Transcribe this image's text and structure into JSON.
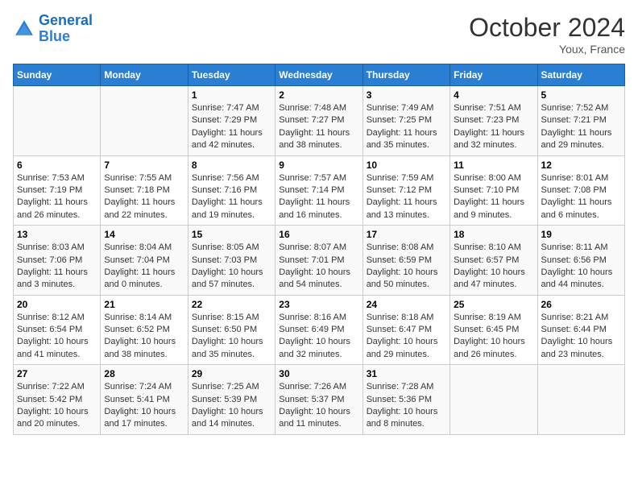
{
  "logo": {
    "line1": "General",
    "line2": "Blue"
  },
  "title": "October 2024",
  "location": "Youx, France",
  "days_of_week": [
    "Sunday",
    "Monday",
    "Tuesday",
    "Wednesday",
    "Thursday",
    "Friday",
    "Saturday"
  ],
  "weeks": [
    [
      {
        "day": "",
        "sunrise": "",
        "sunset": "",
        "daylight": ""
      },
      {
        "day": "",
        "sunrise": "",
        "sunset": "",
        "daylight": ""
      },
      {
        "day": "1",
        "sunrise": "Sunrise: 7:47 AM",
        "sunset": "Sunset: 7:29 PM",
        "daylight": "Daylight: 11 hours and 42 minutes."
      },
      {
        "day": "2",
        "sunrise": "Sunrise: 7:48 AM",
        "sunset": "Sunset: 7:27 PM",
        "daylight": "Daylight: 11 hours and 38 minutes."
      },
      {
        "day": "3",
        "sunrise": "Sunrise: 7:49 AM",
        "sunset": "Sunset: 7:25 PM",
        "daylight": "Daylight: 11 hours and 35 minutes."
      },
      {
        "day": "4",
        "sunrise": "Sunrise: 7:51 AM",
        "sunset": "Sunset: 7:23 PM",
        "daylight": "Daylight: 11 hours and 32 minutes."
      },
      {
        "day": "5",
        "sunrise": "Sunrise: 7:52 AM",
        "sunset": "Sunset: 7:21 PM",
        "daylight": "Daylight: 11 hours and 29 minutes."
      }
    ],
    [
      {
        "day": "6",
        "sunrise": "Sunrise: 7:53 AM",
        "sunset": "Sunset: 7:19 PM",
        "daylight": "Daylight: 11 hours and 26 minutes."
      },
      {
        "day": "7",
        "sunrise": "Sunrise: 7:55 AM",
        "sunset": "Sunset: 7:18 PM",
        "daylight": "Daylight: 11 hours and 22 minutes."
      },
      {
        "day": "8",
        "sunrise": "Sunrise: 7:56 AM",
        "sunset": "Sunset: 7:16 PM",
        "daylight": "Daylight: 11 hours and 19 minutes."
      },
      {
        "day": "9",
        "sunrise": "Sunrise: 7:57 AM",
        "sunset": "Sunset: 7:14 PM",
        "daylight": "Daylight: 11 hours and 16 minutes."
      },
      {
        "day": "10",
        "sunrise": "Sunrise: 7:59 AM",
        "sunset": "Sunset: 7:12 PM",
        "daylight": "Daylight: 11 hours and 13 minutes."
      },
      {
        "day": "11",
        "sunrise": "Sunrise: 8:00 AM",
        "sunset": "Sunset: 7:10 PM",
        "daylight": "Daylight: 11 hours and 9 minutes."
      },
      {
        "day": "12",
        "sunrise": "Sunrise: 8:01 AM",
        "sunset": "Sunset: 7:08 PM",
        "daylight": "Daylight: 11 hours and 6 minutes."
      }
    ],
    [
      {
        "day": "13",
        "sunrise": "Sunrise: 8:03 AM",
        "sunset": "Sunset: 7:06 PM",
        "daylight": "Daylight: 11 hours and 3 minutes."
      },
      {
        "day": "14",
        "sunrise": "Sunrise: 8:04 AM",
        "sunset": "Sunset: 7:04 PM",
        "daylight": "Daylight: 11 hours and 0 minutes."
      },
      {
        "day": "15",
        "sunrise": "Sunrise: 8:05 AM",
        "sunset": "Sunset: 7:03 PM",
        "daylight": "Daylight: 10 hours and 57 minutes."
      },
      {
        "day": "16",
        "sunrise": "Sunrise: 8:07 AM",
        "sunset": "Sunset: 7:01 PM",
        "daylight": "Daylight: 10 hours and 54 minutes."
      },
      {
        "day": "17",
        "sunrise": "Sunrise: 8:08 AM",
        "sunset": "Sunset: 6:59 PM",
        "daylight": "Daylight: 10 hours and 50 minutes."
      },
      {
        "day": "18",
        "sunrise": "Sunrise: 8:10 AM",
        "sunset": "Sunset: 6:57 PM",
        "daylight": "Daylight: 10 hours and 47 minutes."
      },
      {
        "day": "19",
        "sunrise": "Sunrise: 8:11 AM",
        "sunset": "Sunset: 6:56 PM",
        "daylight": "Daylight: 10 hours and 44 minutes."
      }
    ],
    [
      {
        "day": "20",
        "sunrise": "Sunrise: 8:12 AM",
        "sunset": "Sunset: 6:54 PM",
        "daylight": "Daylight: 10 hours and 41 minutes."
      },
      {
        "day": "21",
        "sunrise": "Sunrise: 8:14 AM",
        "sunset": "Sunset: 6:52 PM",
        "daylight": "Daylight: 10 hours and 38 minutes."
      },
      {
        "day": "22",
        "sunrise": "Sunrise: 8:15 AM",
        "sunset": "Sunset: 6:50 PM",
        "daylight": "Daylight: 10 hours and 35 minutes."
      },
      {
        "day": "23",
        "sunrise": "Sunrise: 8:16 AM",
        "sunset": "Sunset: 6:49 PM",
        "daylight": "Daylight: 10 hours and 32 minutes."
      },
      {
        "day": "24",
        "sunrise": "Sunrise: 8:18 AM",
        "sunset": "Sunset: 6:47 PM",
        "daylight": "Daylight: 10 hours and 29 minutes."
      },
      {
        "day": "25",
        "sunrise": "Sunrise: 8:19 AM",
        "sunset": "Sunset: 6:45 PM",
        "daylight": "Daylight: 10 hours and 26 minutes."
      },
      {
        "day": "26",
        "sunrise": "Sunrise: 8:21 AM",
        "sunset": "Sunset: 6:44 PM",
        "daylight": "Daylight: 10 hours and 23 minutes."
      }
    ],
    [
      {
        "day": "27",
        "sunrise": "Sunrise: 7:22 AM",
        "sunset": "Sunset: 5:42 PM",
        "daylight": "Daylight: 10 hours and 20 minutes."
      },
      {
        "day": "28",
        "sunrise": "Sunrise: 7:24 AM",
        "sunset": "Sunset: 5:41 PM",
        "daylight": "Daylight: 10 hours and 17 minutes."
      },
      {
        "day": "29",
        "sunrise": "Sunrise: 7:25 AM",
        "sunset": "Sunset: 5:39 PM",
        "daylight": "Daylight: 10 hours and 14 minutes."
      },
      {
        "day": "30",
        "sunrise": "Sunrise: 7:26 AM",
        "sunset": "Sunset: 5:37 PM",
        "daylight": "Daylight: 10 hours and 11 minutes."
      },
      {
        "day": "31",
        "sunrise": "Sunrise: 7:28 AM",
        "sunset": "Sunset: 5:36 PM",
        "daylight": "Daylight: 10 hours and 8 minutes."
      },
      {
        "day": "",
        "sunrise": "",
        "sunset": "",
        "daylight": ""
      },
      {
        "day": "",
        "sunrise": "",
        "sunset": "",
        "daylight": ""
      }
    ]
  ]
}
